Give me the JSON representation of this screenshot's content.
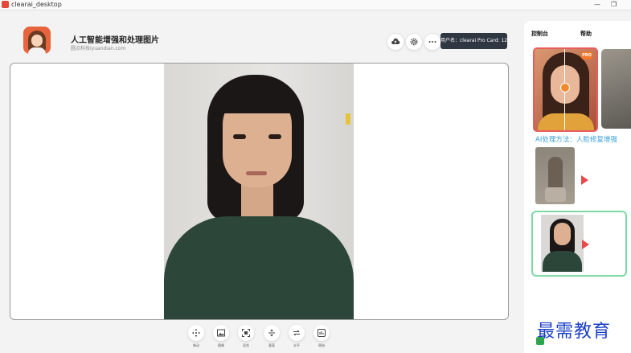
{
  "window": {
    "title": "clearai_desktop",
    "minimize_glyph": "—",
    "maximize_glyph": "❐"
  },
  "header": {
    "app_name": "人工智能增强和处理图片",
    "subtitle": "圆点科技iyuandian.com",
    "user_badge": "用户名：clearai Pro Card: 12",
    "icons": [
      "cloud-upload-icon",
      "gear-icon",
      "more-icon"
    ]
  },
  "toolbar": {
    "items": [
      {
        "icon": "move-icon",
        "label": "移动"
      },
      {
        "icon": "image-icon",
        "label": "图像"
      },
      {
        "icon": "fit-icon",
        "label": "适合"
      },
      {
        "icon": "vertical-flip-icon",
        "label": "垂直"
      },
      {
        "icon": "horizontal-flip-icon",
        "label": "水平"
      },
      {
        "icon": "original-icon",
        "label": "原始"
      }
    ]
  },
  "right_panel": {
    "tabs": [
      "控制台",
      "帮助"
    ],
    "pro_badge": "PRO",
    "caption": "AI处理方法：人脸修复增强"
  },
  "watermark": "最需教育",
  "colors": {
    "badge_bg": "#2f3742",
    "selected_border": "#e85e5e",
    "active_border": "#7ed9a4",
    "caption": "#3aa0d8",
    "play": "#e84b4b"
  }
}
